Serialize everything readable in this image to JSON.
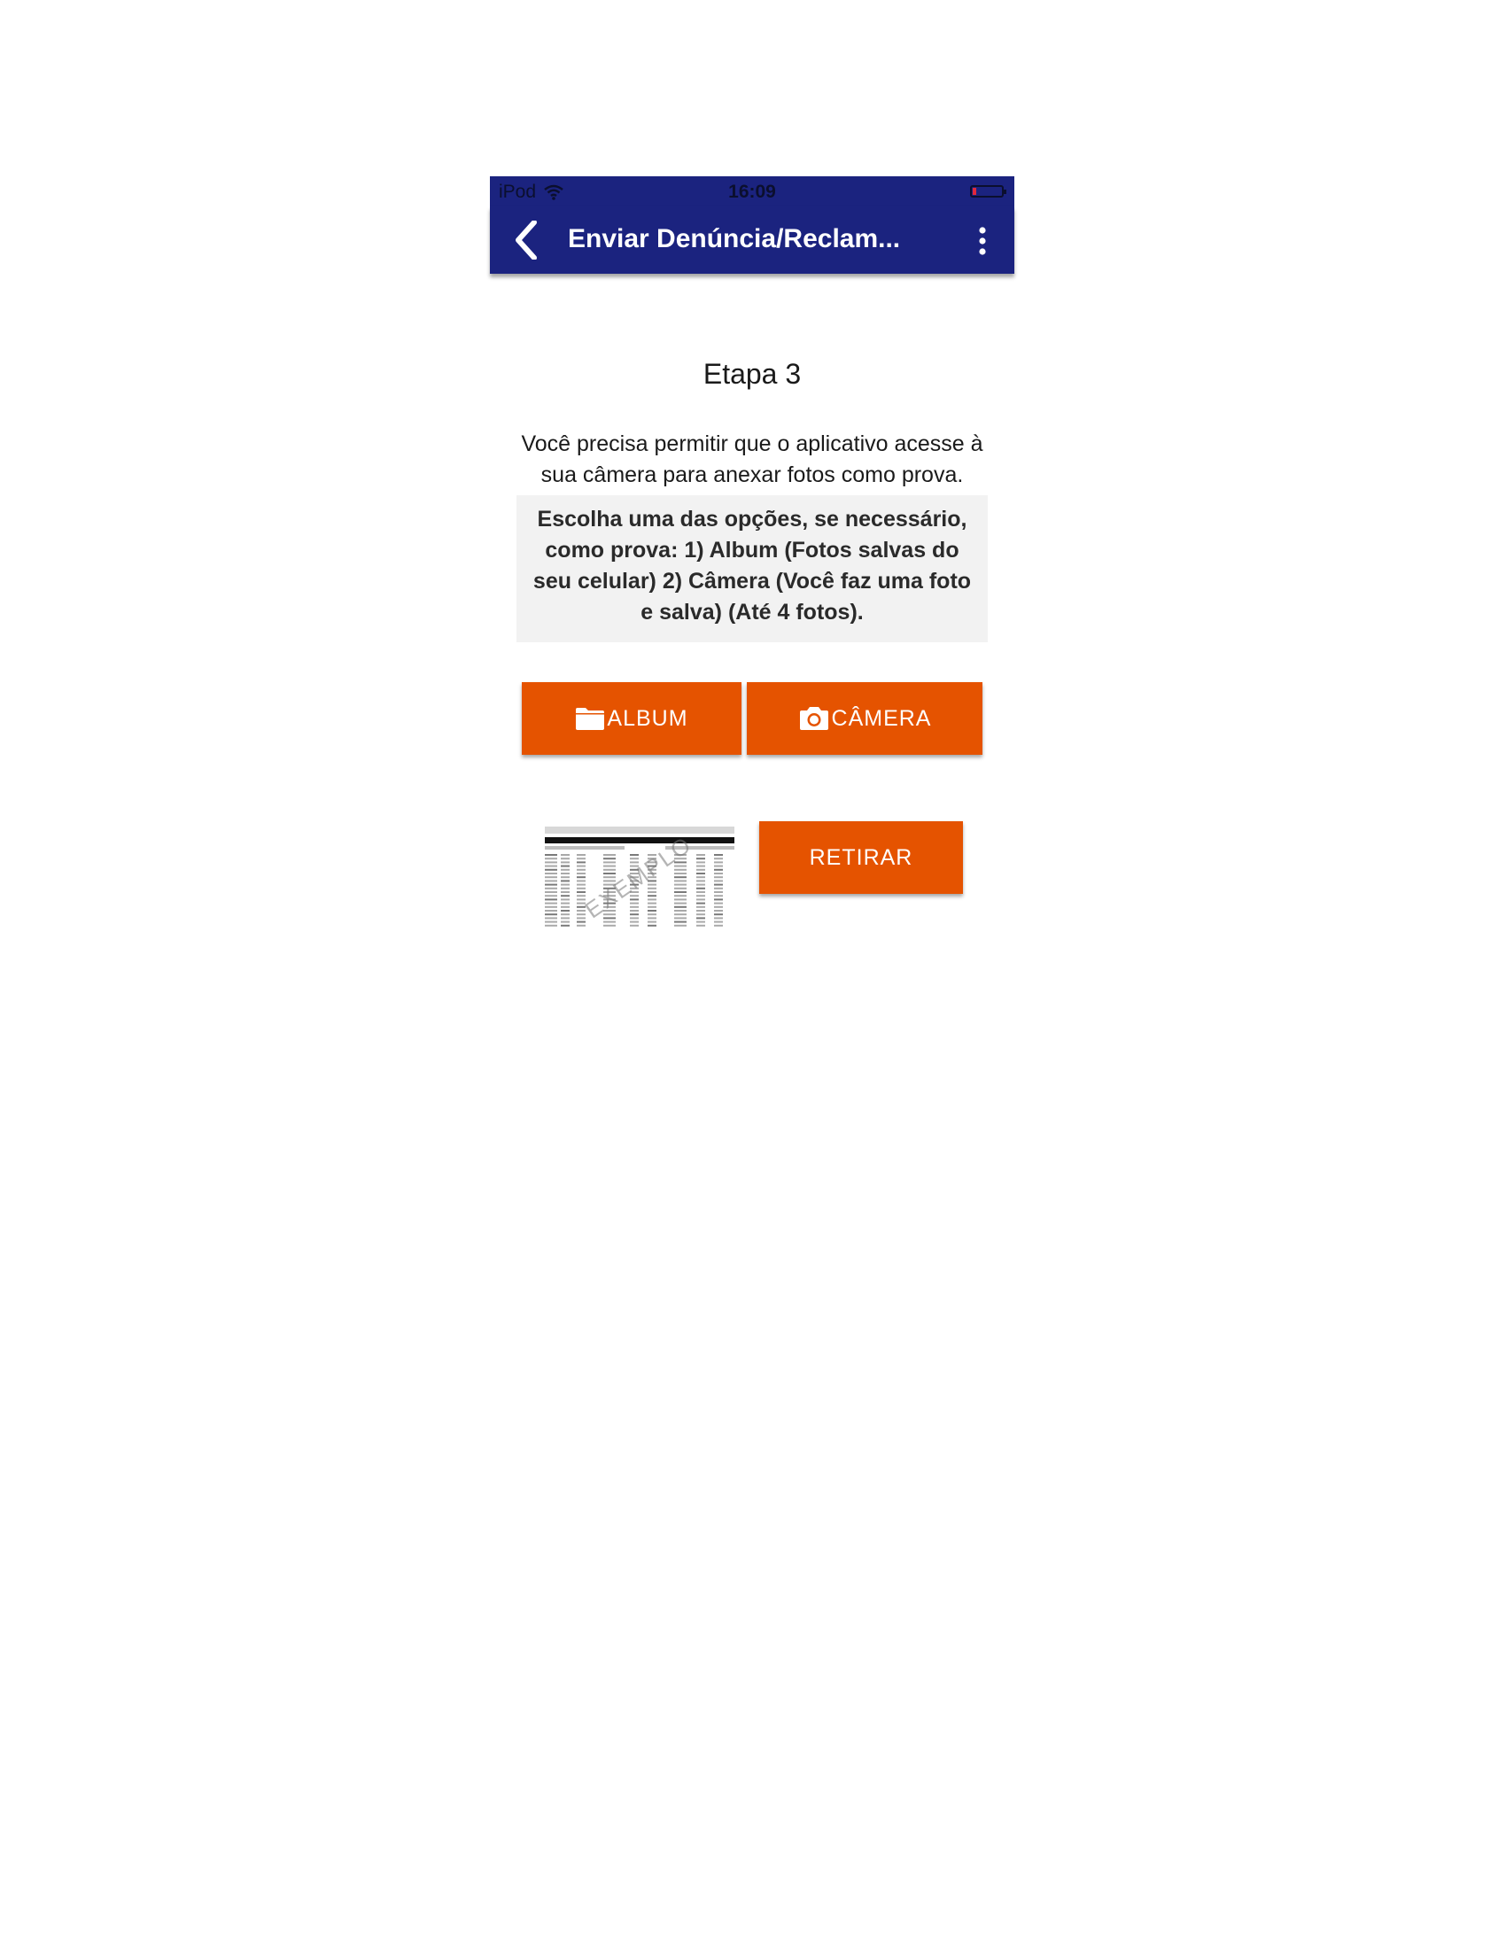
{
  "status_bar": {
    "carrier": "iPod",
    "time": "16:09",
    "battery_level": 0.12,
    "battery_color": "#e0283c"
  },
  "toolbar": {
    "title": "Enviar Denúncia/Reclam...",
    "back_icon": "chevron-left-icon",
    "menu_icon": "more-vertical-icon",
    "color": "#1b237f"
  },
  "content": {
    "step_title": "Etapa 3",
    "permission_text": "Você precisa permitir que o aplicativo acesse à sua câmera para anexar fotos como prova.",
    "instructions": "Escolha uma das opções, se necessário, como prova: 1) Album (Fotos salvas do seu celular) 2) Câmera (Você faz uma foto e salva) (Até 4 fotos).",
    "album_label": "ALBUM",
    "album_icon": "folder-icon",
    "camera_label": "CÂMERA",
    "camera_icon": "camera-icon",
    "remove_label": "RETIRAR",
    "thumbnail_watermark": "EXEMPLO",
    "accent_color": "#e55300"
  }
}
